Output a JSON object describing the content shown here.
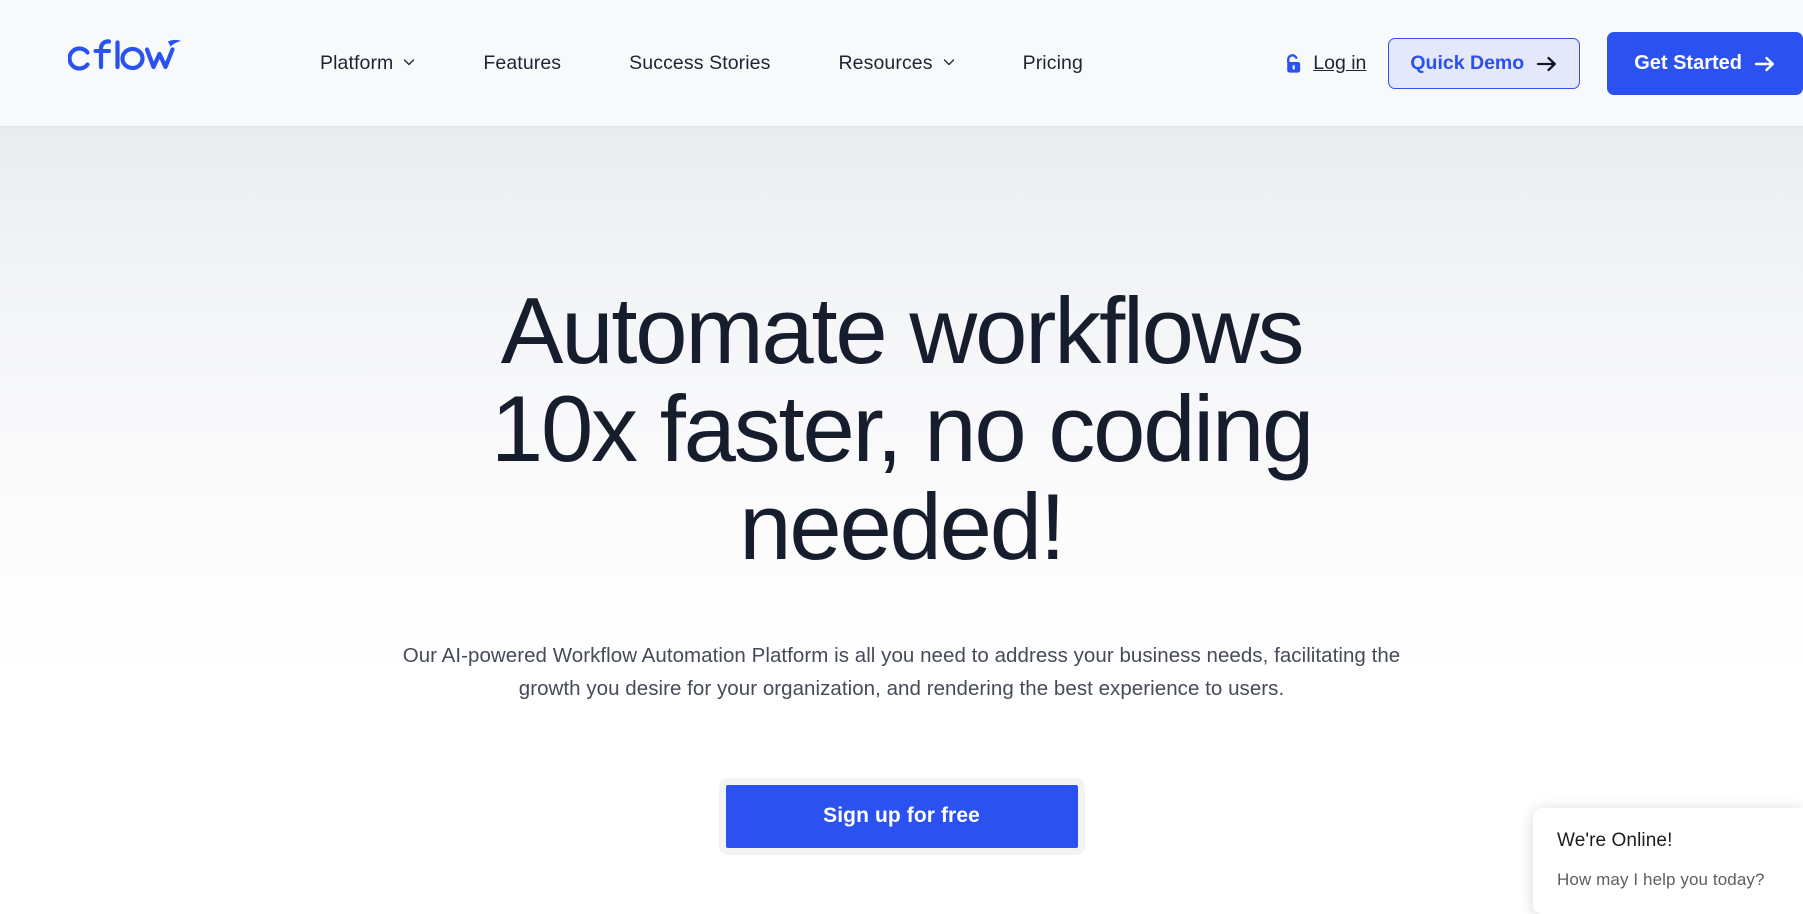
{
  "header": {
    "logo": {
      "name": "cflow",
      "color": "#2b52f0"
    },
    "nav": [
      {
        "label": "Platform",
        "has_chevron": true,
        "icon": "chevron-down-icon"
      },
      {
        "label": "Features",
        "has_chevron": false
      },
      {
        "label": "Success Stories",
        "has_chevron": false
      },
      {
        "label": "Resources",
        "has_chevron": true,
        "icon": "chevron-down-icon"
      },
      {
        "label": "Pricing",
        "has_chevron": false
      }
    ],
    "login": {
      "label": "Log in",
      "icon": "unlock-padlock-icon",
      "icon_color": "#2b52f0"
    },
    "quick_demo": {
      "label": "Quick Demo",
      "icon": "arrow-right-icon",
      "bg": "#e4e8fa",
      "border": "#2f55f0",
      "text_color": "#2a50ee"
    },
    "get_started": {
      "label": "Get Started",
      "icon": "arrow-right-icon",
      "bg": "#2b52f0",
      "text_color": "#ffffff"
    }
  },
  "hero": {
    "headline_line1": "Automate workflows",
    "headline_line2": "10x faster, no coding",
    "headline_line3": "needed!",
    "subhead_line1": "Our AI-powered Workflow Automation Platform is all you need to address your business needs, facilitating the growth",
    "subhead_line2": "you desire for your organization, and rendering the best experience to users.",
    "cta_label": "Sign up for free",
    "cta_bg": "#2b52f0",
    "headline_color": "#161d2d"
  },
  "chat": {
    "title": "We're Online!",
    "subtitle": "How may I help you today?"
  }
}
